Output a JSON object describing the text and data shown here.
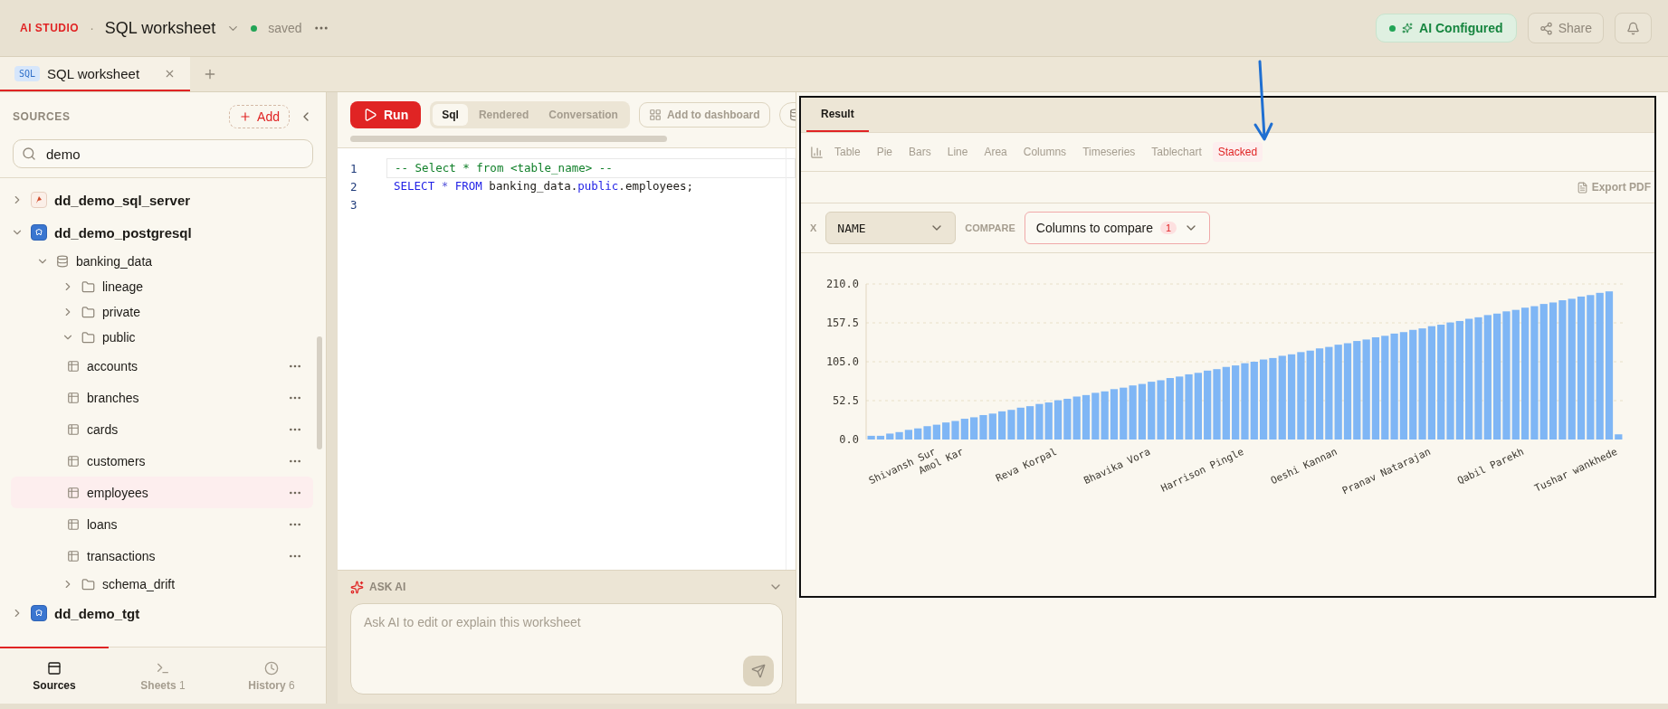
{
  "app": {
    "brand": "AI STUDIO",
    "separator": "·",
    "title": "SQL worksheet",
    "status": "saved"
  },
  "header_actions": {
    "ai_status": "AI Configured",
    "share": "Share"
  },
  "tabs": [
    {
      "badge": "SQL",
      "label": "SQL worksheet",
      "selected": true
    }
  ],
  "sidebar": {
    "title": "SOURCES",
    "add_button": "Add",
    "search": {
      "value": "demo"
    },
    "tree": [
      {
        "kind": "mssql",
        "label": "dd_demo_sql_server",
        "expanded": false
      },
      {
        "kind": "postgres",
        "label": "dd_demo_postgresql",
        "expanded": true,
        "children": [
          {
            "kind": "database",
            "label": "banking_data",
            "expanded": true,
            "children": [
              {
                "kind": "folder",
                "label": "lineage",
                "expanded": false
              },
              {
                "kind": "folder",
                "label": "private",
                "expanded": false
              },
              {
                "kind": "folder",
                "label": "public",
                "expanded": true,
                "children": [
                  {
                    "kind": "table",
                    "label": "accounts",
                    "selected": false
                  },
                  {
                    "kind": "table",
                    "label": "branches",
                    "selected": false
                  },
                  {
                    "kind": "table",
                    "label": "cards",
                    "selected": false
                  },
                  {
                    "kind": "table",
                    "label": "customers",
                    "selected": false
                  },
                  {
                    "kind": "table",
                    "label": "employees",
                    "selected": true
                  },
                  {
                    "kind": "table",
                    "label": "loans",
                    "selected": false
                  },
                  {
                    "kind": "table",
                    "label": "transactions",
                    "selected": false
                  }
                ]
              },
              {
                "kind": "folder",
                "label": "schema_drift",
                "expanded": false
              }
            ]
          }
        ]
      },
      {
        "kind": "postgres",
        "label": "dd_demo_tgt",
        "expanded": false
      }
    ],
    "nav": [
      {
        "kind": "sources",
        "label": "Sources",
        "selected": true
      },
      {
        "kind": "sheets",
        "label": "Sheets",
        "count": "1",
        "selected": false
      },
      {
        "kind": "history",
        "label": "History",
        "count": "6",
        "selected": false
      }
    ]
  },
  "editor": {
    "run_button": "Run",
    "modes": [
      {
        "label": "Sql",
        "selected": true
      },
      {
        "label": "Rendered",
        "selected": false
      },
      {
        "label": "Conversation",
        "selected": false
      }
    ],
    "add_to_dashboard": "Add to dashboard",
    "lines": [
      {
        "number": "1",
        "tokens": [
          {
            "kind": "comment",
            "text": "-- Select * from <table_name> --"
          }
        ]
      },
      {
        "number": "2",
        "tokens": [
          {
            "kind": "keyword",
            "text": "SELECT"
          },
          {
            "kind": "operator",
            "text": " * "
          },
          {
            "kind": "keyword",
            "text": "FROM"
          },
          {
            "kind": "plain",
            "text": " banking_data."
          },
          {
            "kind": "keyword",
            "text": "public"
          },
          {
            "kind": "plain",
            "text": ".employees;"
          }
        ]
      },
      {
        "number": "3"
      }
    ]
  },
  "ask_ai": {
    "title": "ASK AI",
    "placeholder": "Ask AI to edit or explain this worksheet"
  },
  "result": {
    "tabs": [
      {
        "label": "Result",
        "selected": true
      }
    ],
    "chart_types": [
      {
        "label": "Table",
        "selected": false
      },
      {
        "label": "Pie",
        "selected": false
      },
      {
        "label": "Bars",
        "selected": false
      },
      {
        "label": "Line",
        "selected": false
      },
      {
        "label": "Area",
        "selected": false
      },
      {
        "label": "Columns",
        "selected": false
      },
      {
        "label": "Timeseries",
        "selected": false
      },
      {
        "label": "Tablechart",
        "selected": false
      },
      {
        "label": "Stacked",
        "selected": true
      }
    ],
    "export": "Export PDF",
    "x_label": "X",
    "x_value": "NAME",
    "compare_label": "COMPARE",
    "compare_value": "Columns to compare",
    "compare_count": "1",
    "chart_data": {
      "type": "bar",
      "grid": true,
      "categories": [
        null,
        null,
        null,
        null,
        null,
        null,
        null,
        "Shivansh Sur",
        null,
        null,
        "Amol Kar",
        null,
        null,
        null,
        null,
        null,
        null,
        null,
        null,
        null,
        "Reva Korpal",
        null,
        null,
        null,
        null,
        null,
        null,
        null,
        null,
        null,
        "Bhavika Vora",
        null,
        null,
        null,
        null,
        null,
        null,
        null,
        null,
        null,
        "Harrison Pingle",
        null,
        null,
        null,
        null,
        null,
        null,
        null,
        null,
        null,
        "Oeshi Kannan",
        null,
        null,
        null,
        null,
        null,
        null,
        null,
        null,
        null,
        "Pranav Natarajan",
        null,
        null,
        null,
        null,
        null,
        null,
        null,
        null,
        null,
        "Qabil Parekh",
        null,
        null,
        null,
        null,
        null,
        null,
        null,
        null,
        null,
        "Tushar wankhede"
      ],
      "values": [
        5,
        5,
        8,
        10,
        13,
        15,
        18,
        20,
        23,
        25,
        28,
        30,
        33,
        35,
        38,
        40,
        43,
        45,
        48,
        50,
        53,
        55,
        58,
        60,
        63,
        65,
        68,
        70,
        73,
        75,
        78,
        80,
        83,
        85,
        88,
        90,
        93,
        95,
        98,
        100,
        103,
        105,
        108,
        110,
        113,
        115,
        118,
        120,
        123,
        125,
        128,
        130,
        133,
        135,
        138,
        140,
        143,
        145,
        148,
        150,
        153,
        155,
        158,
        160,
        163,
        165,
        168,
        170,
        173,
        175,
        178,
        180,
        183,
        185,
        188,
        190,
        193,
        195,
        198,
        200,
        7
      ],
      "ylim": [
        0,
        210
      ],
      "yticks": [
        {
          "value": 0,
          "label": "0.0"
        },
        {
          "value": 52.5,
          "label": "52.5"
        },
        {
          "value": 105,
          "label": "105.0"
        },
        {
          "value": 157.5,
          "label": "157.5"
        },
        {
          "value": 210,
          "label": "210.0"
        }
      ]
    }
  }
}
